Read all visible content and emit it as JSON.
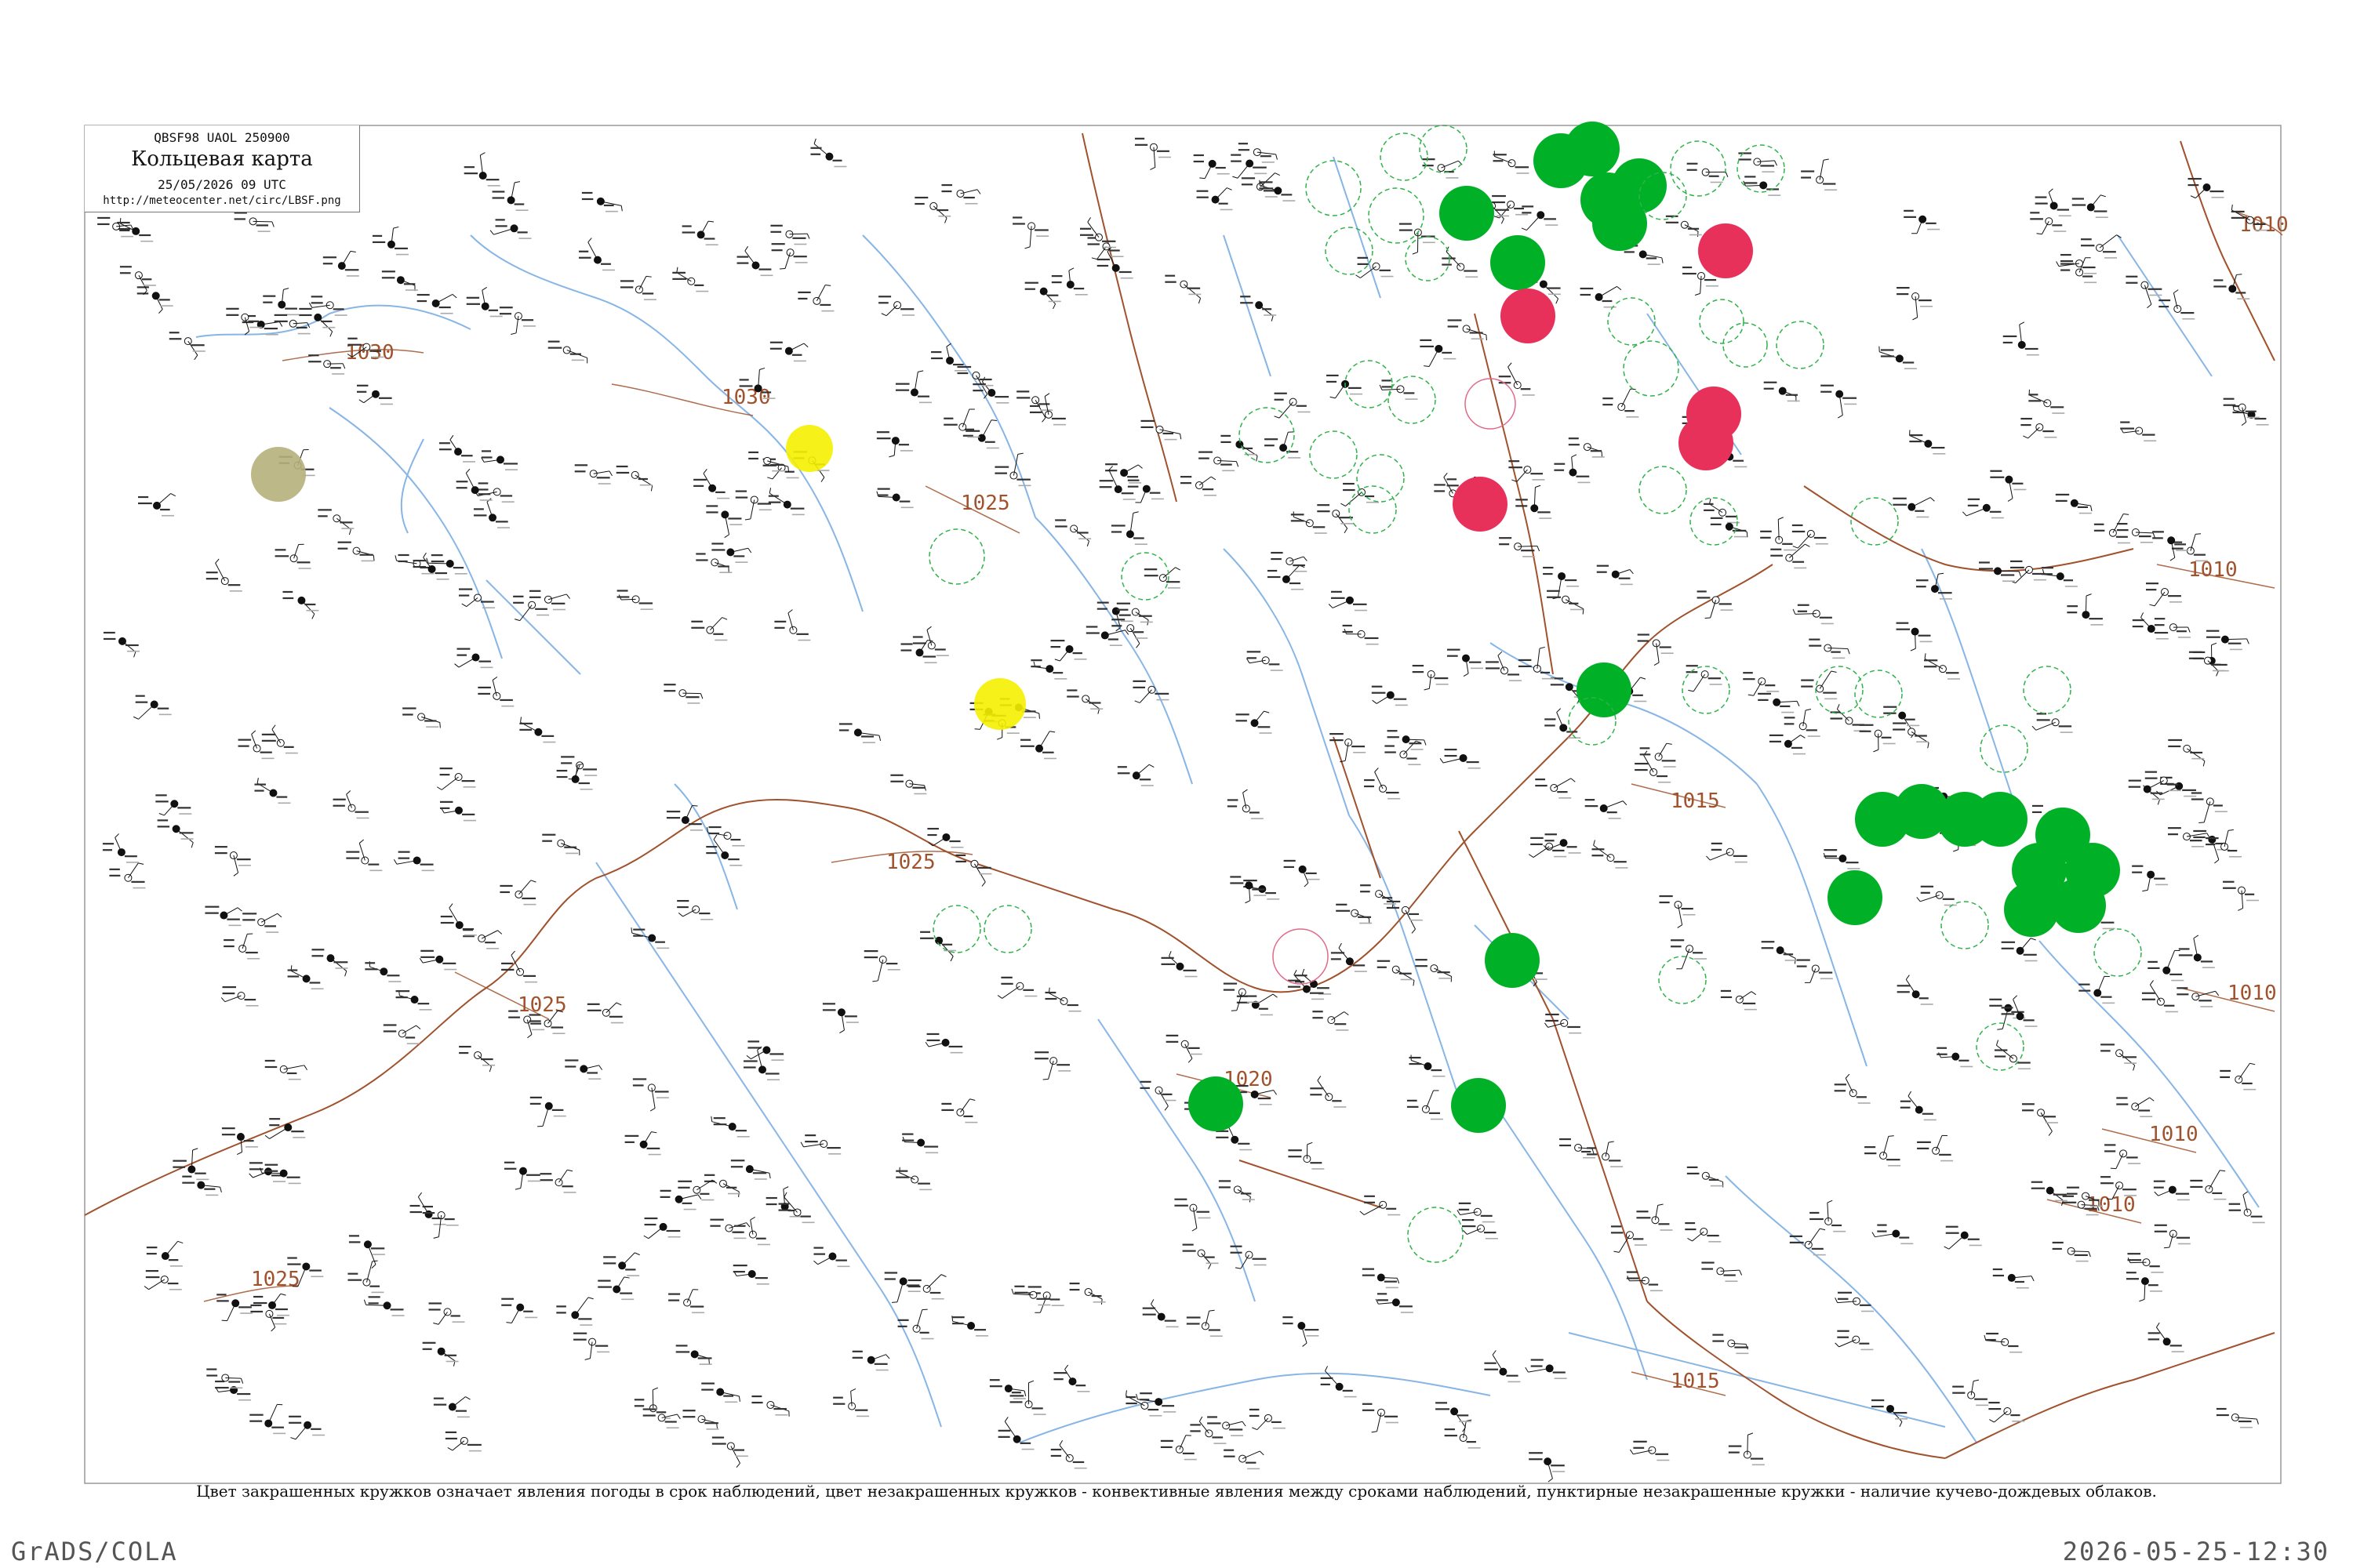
{
  "header": {
    "code_line": "QBSF98  UAOL  250900",
    "title": "Кольцевая карта",
    "datetime": "25/05/2026 09 UTC",
    "url": "http://meteocenter.net/circ/LBSF.png"
  },
  "caption": "Цвет закрашенных кружков означает явления погоды в срок наблюдений, цвет незакрашенных кружков - конвективные явления между сроками наблюдений, пунктирные незакрашенные кружки - наличие кучево-дождевых облаков.",
  "footer": {
    "left": "GrADS/COLA",
    "right": "2026-05-25-12:30"
  },
  "colors": {
    "isobar": "#a0522d",
    "border": "#8b4513",
    "water": "#87b5e6",
    "frame": "#999999",
    "rain": "#00b026",
    "thunder": "#e8315a",
    "haze": "#f5f000",
    "fog": "#b5b07a",
    "cb_dashed": "#2fb34a",
    "thunder_ring": "#e06a8a"
  },
  "isobars": [
    {
      "label": "1030"
    },
    {
      "label": "1030"
    },
    {
      "label": "1025"
    },
    {
      "label": "1025"
    },
    {
      "label": "1025"
    },
    {
      "label": "1025"
    },
    {
      "label": "1020"
    },
    {
      "label": "1015"
    },
    {
      "label": "1015"
    },
    {
      "label": "1010"
    },
    {
      "label": "1010"
    },
    {
      "label": "1010"
    },
    {
      "label": "1010"
    },
    {
      "label": "1010"
    }
  ]
}
